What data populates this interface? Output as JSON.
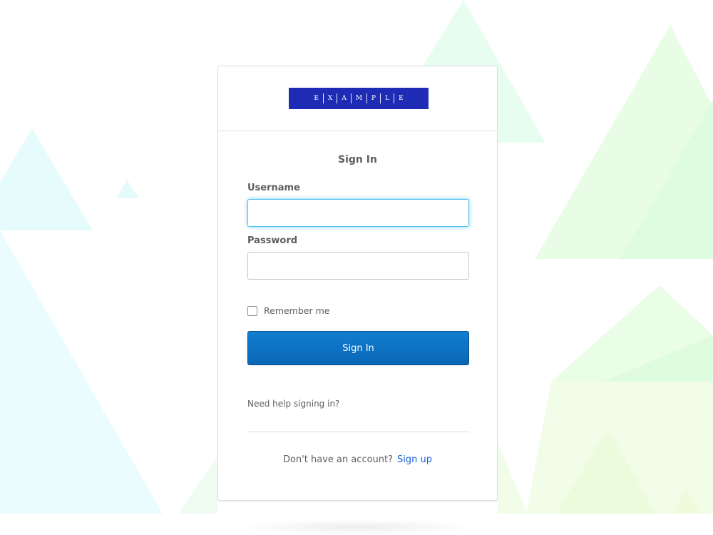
{
  "logo": {
    "letters": [
      "E",
      "X",
      "A",
      "M",
      "P",
      "L",
      "E"
    ],
    "bg_color": "#1d2bb5"
  },
  "form": {
    "title": "Sign In",
    "username_label": "Username",
    "username_value": "",
    "password_label": "Password",
    "password_value": "",
    "remember_label": "Remember me",
    "remember_checked": false,
    "submit_label": "Sign In",
    "help_link": "Need help signing in?"
  },
  "signup": {
    "prompt": "Don't have an account?",
    "link": "Sign up"
  },
  "colors": {
    "primary_button": "#0b6fc4",
    "link": "#1662dd",
    "focus_ring": "#51c1ef"
  }
}
